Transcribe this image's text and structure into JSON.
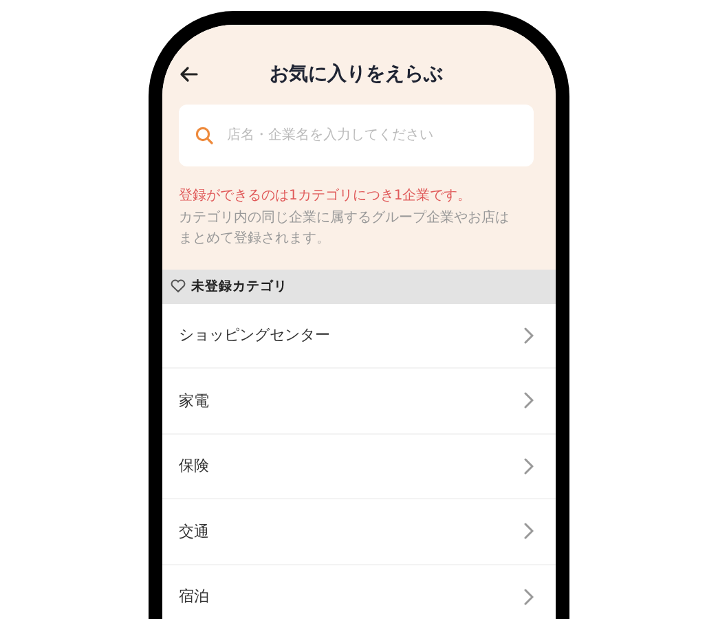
{
  "header": {
    "title": "お気に入りをえらぶ"
  },
  "search": {
    "placeholder": "店名・企業名を入力してください"
  },
  "notice": {
    "highlight": "登録ができるのは1カテゴリにつき1企業です。",
    "body": "カテゴリ内の同じ企業に属するグループ企業やお店はまとめて登録されます。"
  },
  "section": {
    "title": "未登録カテゴリ"
  },
  "categories": [
    {
      "label": "ショッピングセンター"
    },
    {
      "label": "家電"
    },
    {
      "label": "保険"
    },
    {
      "label": "交通"
    },
    {
      "label": "宿泊"
    }
  ]
}
